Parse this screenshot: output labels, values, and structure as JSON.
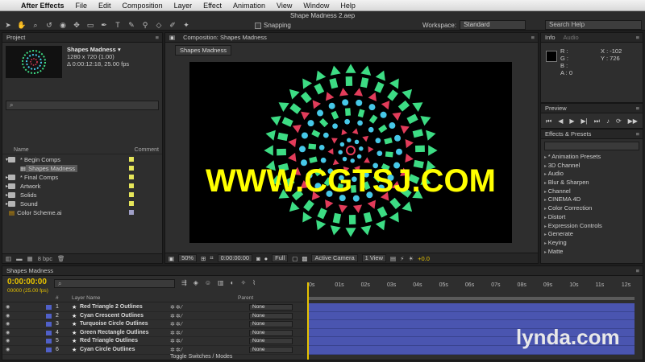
{
  "menubar": {
    "app_name": "After Effects",
    "items": [
      "File",
      "Edit",
      "Composition",
      "Layer",
      "Effect",
      "Animation",
      "View",
      "Window",
      "Help"
    ]
  },
  "toolbar": {
    "window_title": "Shape Madness 2.aep",
    "snapping_label": "Snapping",
    "workspace_label": "Workspace:",
    "workspace_value": "Standard",
    "search_placeholder": "Search Help"
  },
  "project": {
    "tab_label": "Project",
    "comp_name": "Shapes Madness ▾",
    "comp_size": "1280 x 720 (1.00)",
    "comp_duration": "Δ 0:00:12:18, 25.00 fps",
    "col_name": "Name",
    "col_comment": "Comment",
    "items": [
      {
        "label": "* Begin Comps",
        "color": "#e6e65a"
      },
      {
        "label": "Shapes Madness",
        "color": "#e6e65a"
      },
      {
        "label": "* Final Comps",
        "color": "#e6e65a"
      },
      {
        "label": "Artwork",
        "color": "#e6e65a"
      },
      {
        "label": "Solids",
        "color": "#e6e65a"
      },
      {
        "label": "Sound",
        "color": "#e6e65a"
      },
      {
        "label": "Color Scheme.ai",
        "color": "#a0a0c8"
      }
    ],
    "bpc": "8 bpc"
  },
  "composition": {
    "tab_label": "Composition: Shapes Madness",
    "subtab_label": "Shapes Madness",
    "watermark": "WWW.CGTSJ.COM",
    "zoom": "50%",
    "timecode": "0:00:00:00",
    "resolution": "Full",
    "camera": "Active Camera",
    "views": "1 View",
    "exposure": "+0.0"
  },
  "info": {
    "tab_label": "Info",
    "tab_audio": "Audio",
    "r": "R :",
    "g": "G :",
    "b": "B :",
    "a": "A : 0",
    "x": "X : -102",
    "y": "Y : 726"
  },
  "preview": {
    "tab_label": "Preview"
  },
  "effects": {
    "tab_label": "Effects & Presets",
    "items": [
      "* Animation Presets",
      "3D Channel",
      "Audio",
      "Blur & Sharpen",
      "Channel",
      "CINEMA 4D",
      "Color Correction",
      "Distort",
      "Expression Controls",
      "Generate",
      "Keying",
      "Matte"
    ]
  },
  "timeline": {
    "tab_label": "Shapes Madness",
    "timecode": "0:00:00:00",
    "fps_readout": "00000 (25.00 fps)",
    "col_layer_name": "Layer Name",
    "col_parent": "Parent",
    "col_num": "#",
    "layers": [
      {
        "num": "1",
        "name": "Red Triangle 2 Outlines",
        "parent": "None"
      },
      {
        "num": "2",
        "name": "Cyan Crescent Outlines",
        "parent": "None"
      },
      {
        "num": "3",
        "name": "Turquoise Circle Outlines",
        "parent": "None"
      },
      {
        "num": "4",
        "name": "Green Rectangle Outlines",
        "parent": "None"
      },
      {
        "num": "5",
        "name": "Red Triangle Outlines",
        "parent": "None"
      },
      {
        "num": "6",
        "name": "Cyan Circle Outlines",
        "parent": "None"
      }
    ],
    "ruler_ticks": [
      "0s",
      "01s",
      "02s",
      "03s",
      "04s",
      "05s",
      "06s",
      "07s",
      "08s",
      "09s",
      "10s",
      "11s",
      "12s"
    ],
    "footer_label": "Toggle Switches / Modes"
  },
  "brand": {
    "watermark": "lynda.com"
  }
}
